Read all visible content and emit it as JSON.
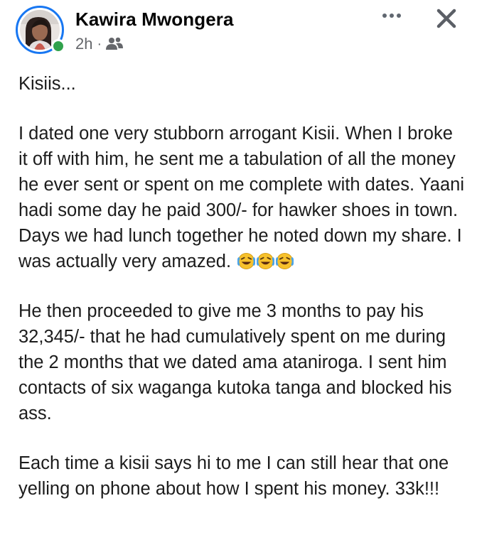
{
  "post": {
    "author": "Kawira Mwongera",
    "time": "2h",
    "separator": "·",
    "audience_icon": "friends-icon",
    "more_icon": "more-horizontal-icon",
    "close_icon": "close-icon",
    "avatar_icon": "profile-photo",
    "online_color": "#31a24c",
    "avatar_ring_color": "#1877f2"
  },
  "body": {
    "opening": "Kisiis...",
    "paragraph_1": "I dated one very stubborn arrogant Kisii. When I broke it off with him, he sent me a tabulation of all the money he ever sent or spent on me complete with dates. Yaani hadi some day he paid 300/- for hawker shoes in town. Days we had lunch together he noted down my share. I was actually very amazed.",
    "paragraph_1_emojis": [
      "rolling-on-floor-laughing",
      "rolling-on-floor-laughing",
      "rolling-on-floor-laughing"
    ],
    "paragraph_2": "He then proceeded to give me 3 months to pay his 32,345/- that he had cumulatively spent on me during the 2 months that we dated ama ataniroga. I sent him contacts of six waganga kutoka tanga and blocked his ass.",
    "paragraph_3": "Each time a kisii says hi to me I can still hear that one yelling on phone about how I spent his money. 33k!!!"
  }
}
